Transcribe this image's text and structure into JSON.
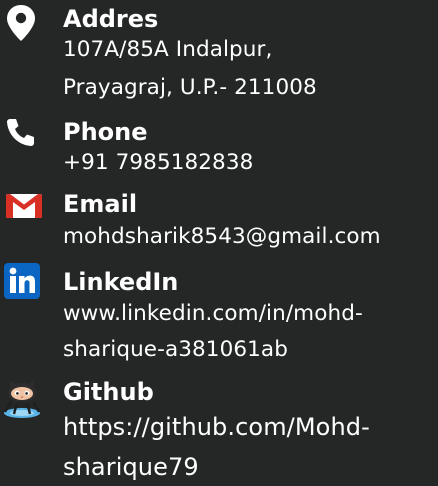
{
  "contacts": {
    "address": {
      "icon": "map-pin-icon",
      "title": "Addres",
      "line1": "107A/85A Indalpur,",
      "line2": "Prayagraj, U.P.- 211008"
    },
    "phone": {
      "icon": "phone-icon",
      "title": "Phone",
      "value": "+91 7985182838"
    },
    "email": {
      "icon": "gmail-icon",
      "title": "Email",
      "value": "mohdsharik8543@gmail.com"
    },
    "linkedin": {
      "icon": "linkedin-icon",
      "title": "LinkedIn",
      "line1": "www.linkedin.com/in/mohd-",
      "line2": "sharique-a381061ab"
    },
    "github": {
      "icon": "github-octocat-icon",
      "title": "Github",
      "line1": "https://github.com/Mohd-",
      "line2": "sharique79"
    }
  },
  "colors": {
    "background": "#252727",
    "text": "#ffffff",
    "gmail_red": "#d93025",
    "linkedin_blue": "#0a66c2"
  }
}
